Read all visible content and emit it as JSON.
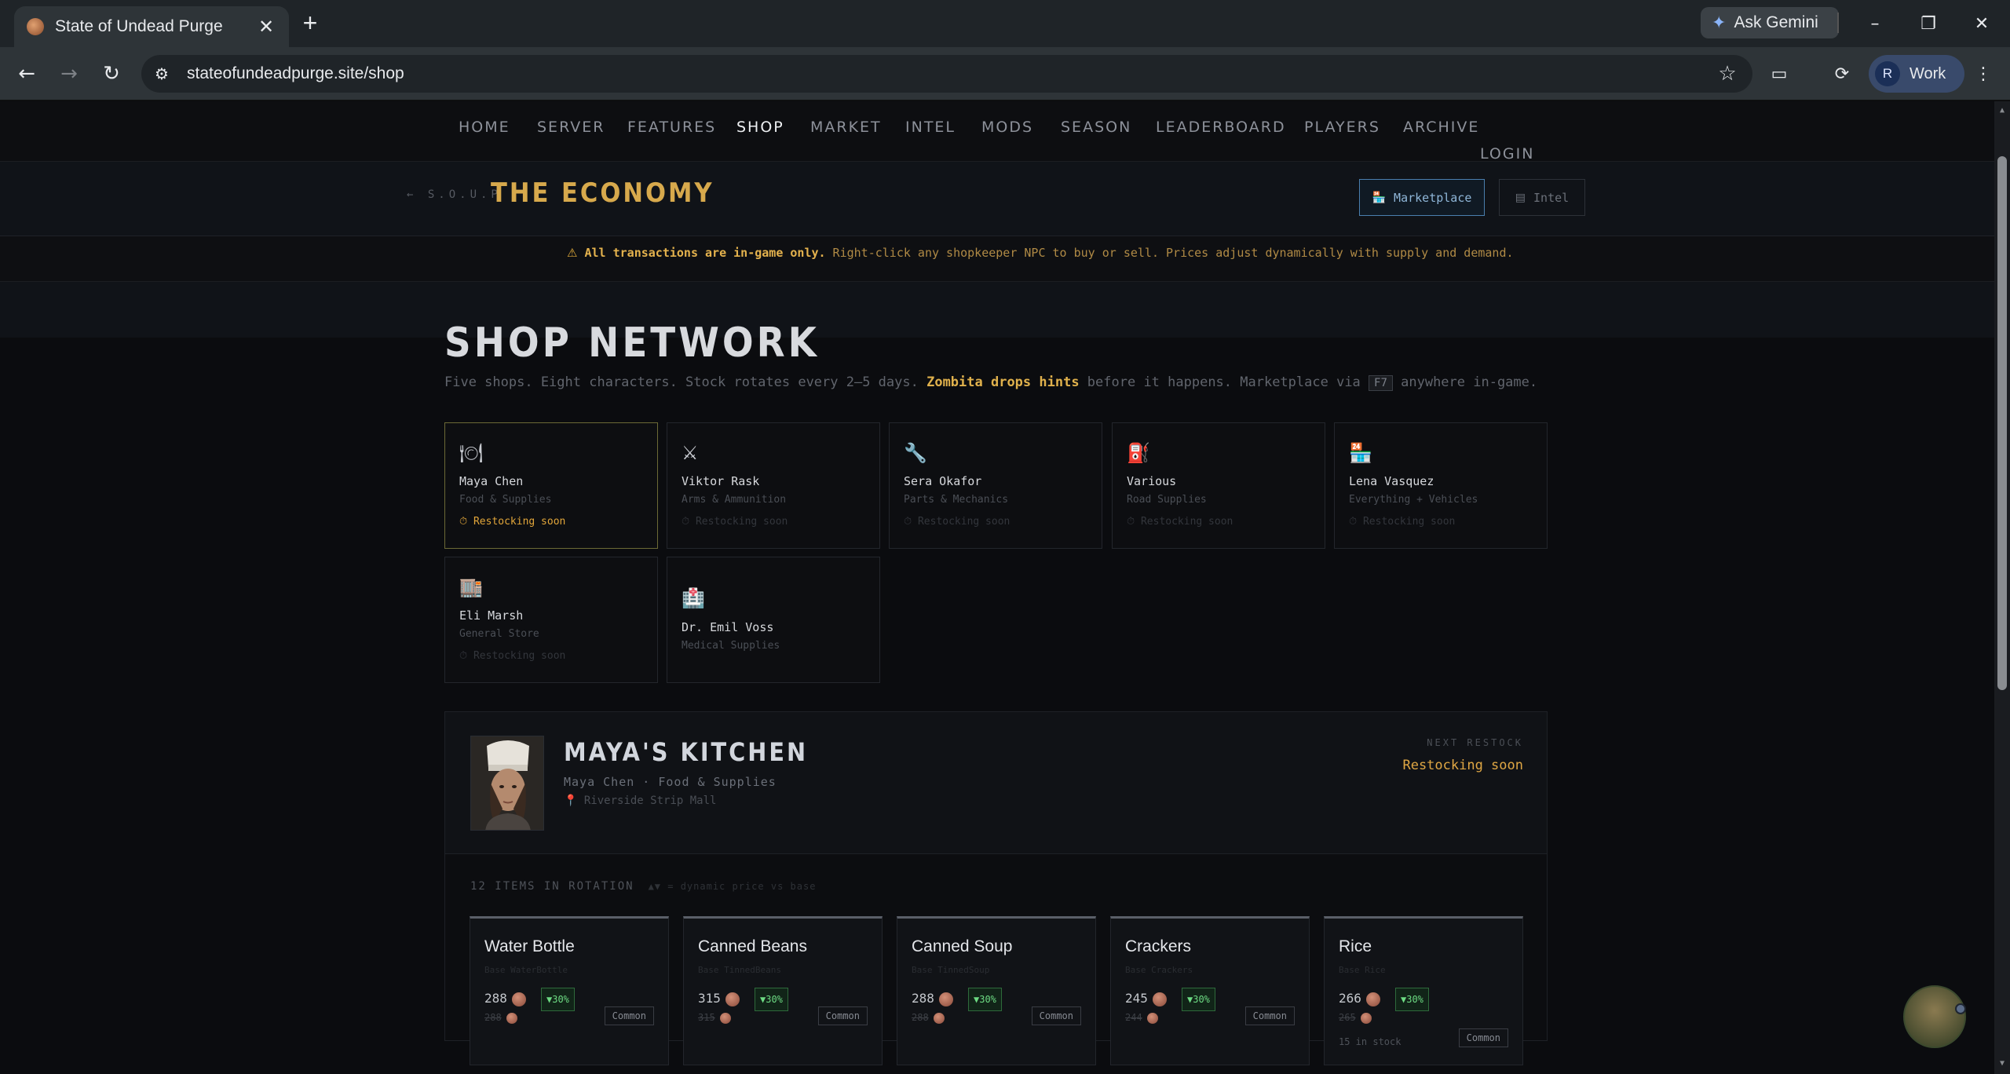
{
  "browser": {
    "tab_title": "State of Undead Purge",
    "tab_close": "✕",
    "new_tab": "+",
    "gemini_label": "Ask Gemini",
    "url": "stateofundeadpurge.site/shop",
    "profile_initial": "R",
    "profile_label": "Work",
    "icons": [
      "favicon",
      "close-icon",
      "plus-icon",
      "gemini-icon",
      "minimize-icon",
      "restore-icon",
      "window-close-icon",
      "back-icon",
      "forward-icon",
      "reload-icon",
      "site-info-icon",
      "star-icon",
      "cast-icon",
      "extensions-icon",
      "menu-icon"
    ]
  },
  "nav": {
    "items": [
      "HOME",
      "SERVER",
      "FEATURES",
      "SHOP",
      "MARKET",
      "INTEL",
      "MODS",
      "SEASON",
      "LEADERBOARD",
      "PLAYERS",
      "ARCHIVE"
    ],
    "login": "LOGIN",
    "active": "SHOP"
  },
  "economy": {
    "back_label": "← S.O.U.P",
    "title": "THE ECONOMY",
    "marketplace_label": "Marketplace",
    "intel_label": "Intel",
    "notice_strong": "All transactions are in-game only.",
    "notice_text": " Right-click any shopkeeper NPC to buy or sell. Prices adjust dynamically with supply and demand."
  },
  "shop": {
    "title": "SHOP NETWORK",
    "subtitle_a": "Five shops. Eight characters. Stock rotates every 2–5 days. ",
    "subtitle_highlight": "Zombita drops hints",
    "subtitle_b": " before it happens. Marketplace via ",
    "subtitle_key": "F7",
    "subtitle_c": " anywhere in-game.",
    "npcs": [
      {
        "icon": "🍽",
        "name": "Maya Chen",
        "role": "Food & Supplies",
        "status": "⏱ Restocking soon",
        "active": true
      },
      {
        "icon": "⚔",
        "name": "Viktor Rask",
        "role": "Arms & Ammunition",
        "status": "⏱ Restocking soon",
        "active": false
      },
      {
        "icon": "🔧",
        "name": "Sera Okafor",
        "role": "Parts & Mechanics",
        "status": "⏱ Restocking soon",
        "active": false
      },
      {
        "icon": "⛽",
        "name": "Various",
        "role": "Road Supplies",
        "status": "⏱ Restocking soon",
        "active": false
      },
      {
        "icon": "🏪",
        "name": "Lena Vasquez",
        "role": "Everything + Vehicles",
        "status": "⏱ Restocking soon",
        "active": false
      },
      {
        "icon": "🏬",
        "name": "Eli Marsh",
        "role": "General Store",
        "status": "⏱ Restocking soon",
        "active": false
      },
      {
        "icon": "🏥",
        "name": "Dr. Emil Voss",
        "role": "Medical Supplies",
        "status": "",
        "active": false
      }
    ]
  },
  "kitchen": {
    "title": "MAYA'S KITCHEN",
    "subtitle": "Maya Chen · Food & Supplies",
    "location": "Riverside Strip Mall",
    "next_label": "NEXT RESTOCK",
    "next_value": "Restocking soon",
    "items_count": "12 ITEMS IN ROTATION",
    "items_hint": "▲▼ = dynamic price vs base",
    "items": [
      {
        "name": "Water Bottle",
        "base": "Base WaterBottle",
        "price": "288",
        "old": "288",
        "discount": "▼30%",
        "rarity": "Common",
        "stock": ""
      },
      {
        "name": "Canned Beans",
        "base": "Base TinnedBeans",
        "price": "315",
        "old": "315",
        "discount": "▼30%",
        "rarity": "Common",
        "stock": ""
      },
      {
        "name": "Canned Soup",
        "base": "Base TinnedSoup",
        "price": "288",
        "old": "288",
        "discount": "▼30%",
        "rarity": "Common",
        "stock": ""
      },
      {
        "name": "Crackers",
        "base": "Base Crackers",
        "price": "245",
        "old": "244",
        "discount": "▼30%",
        "rarity": "Common",
        "stock": ""
      },
      {
        "name": "Rice",
        "base": "Base Rice",
        "price": "266",
        "old": "265",
        "discount": "▼30%",
        "rarity": "Common",
        "stock": "15 in stock"
      }
    ]
  },
  "colors": {
    "accent_gold": "#d7a94c",
    "marketplace_blue": "#4a7fae",
    "discount_green": "#6ddb83",
    "background": "#0b0c0f"
  }
}
